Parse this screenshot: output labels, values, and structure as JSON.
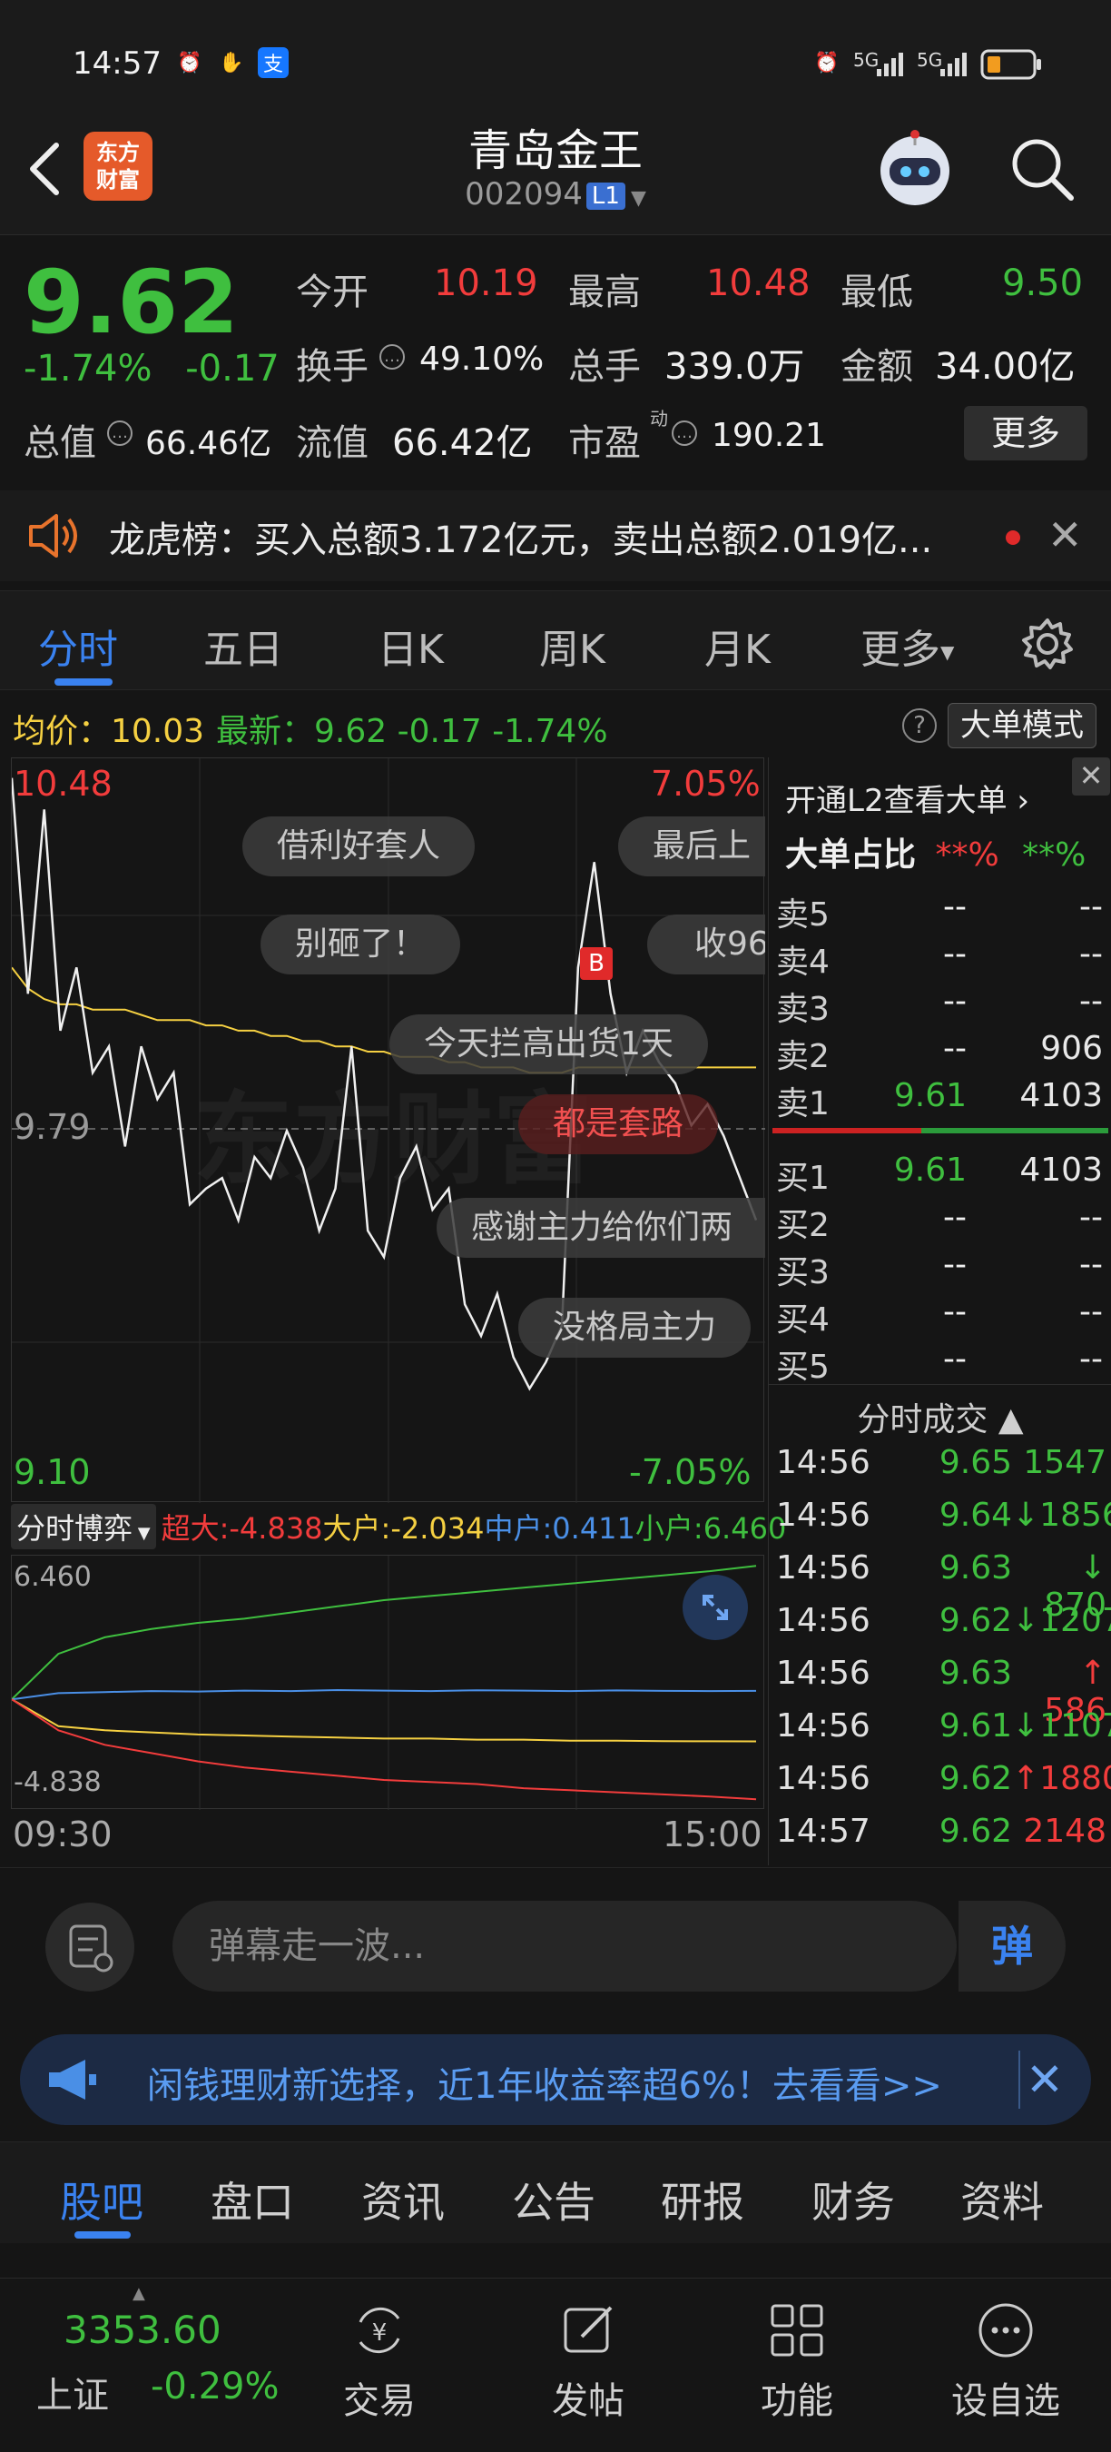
{
  "status_bar": {
    "time": "14:57",
    "net1": "5G",
    "net2": "5G"
  },
  "header": {
    "stock_name": "青岛金王",
    "stock_code": "002094",
    "level_badge": "L1",
    "logo_line1": "东方",
    "logo_line2": "财富"
  },
  "quote": {
    "price": "9.62",
    "change_pct": "-1.74%",
    "change": "-0.17",
    "rows": [
      [
        {
          "k": "今开",
          "v": "10.19",
          "c": "red"
        },
        {
          "k": "最高",
          "v": "10.48",
          "c": "red"
        },
        {
          "k": "最低",
          "v": "9.50",
          "c": "green"
        }
      ],
      [
        {
          "k": "换手",
          "v": "49.10%",
          "c": "white"
        },
        {
          "k": "总手",
          "v": "339.0万",
          "c": "white"
        },
        {
          "k": "金额",
          "v": "34.00亿",
          "c": "white"
        }
      ],
      [
        {
          "k": "总值",
          "v": "66.46亿",
          "c": "white"
        },
        {
          "k": "流值",
          "v": "66.42亿",
          "c": "white"
        },
        {
          "k": "市盈",
          "v": "190.21",
          "c": "white"
        }
      ]
    ],
    "pe_sup": "动",
    "more_label": "更多"
  },
  "notice": {
    "text": "龙虎榜：买入总额3.172亿元，卖出总额2.019亿..."
  },
  "chart_tabs": [
    "分时",
    "五日",
    "日K",
    "周K",
    "月K",
    "更多"
  ],
  "avg_row": {
    "avg": "均价：10.03",
    "latest": "最新：9.62  -0.17  -1.74%",
    "help": "?",
    "big_mode": "大单模式"
  },
  "chart": {
    "y_top": "10.48",
    "pct_top": "7.05%",
    "y_mid": "9.79",
    "y_bottom": "9.10",
    "pct_bottom": "-7.05%",
    "marker": "B",
    "watermark": "东方财富",
    "danmu": [
      "借利好套人",
      "最后上",
      "别砸了！",
      "收96",
      "今天拦高出货1天",
      "都是套路",
      "感谢主力给你们两",
      "没格局主力"
    ]
  },
  "chart_data": {
    "type": "line",
    "title": "",
    "x_range": [
      "09:30",
      "15:00"
    ],
    "ylim": [
      9.1,
      10.48
    ],
    "reference": 9.79,
    "series": [
      {
        "values": [
          10.46,
          10.05,
          10.4,
          9.98,
          10.1,
          9.9,
          9.95,
          9.76,
          9.95,
          9.85,
          9.9,
          9.65,
          9.68,
          9.7,
          9.62,
          9.74,
          9.7,
          9.79,
          9.72,
          9.6,
          9.68,
          9.95,
          9.6,
          9.55,
          9.7,
          9.76,
          9.64,
          9.68,
          9.46,
          9.4,
          9.48,
          9.36,
          9.3,
          9.35,
          9.42,
          10.1,
          10.3,
          10.05,
          9.9,
          9.98,
          9.92,
          9.88,
          9.8,
          9.84,
          9.78,
          9.7,
          9.62
        ]
      },
      {
        "values": [
          10.1,
          10.06,
          10.04,
          10.03,
          10.03,
          10.02,
          10.02,
          10.02,
          10.01,
          10.0,
          10.0,
          10.0,
          9.99,
          9.99,
          9.98,
          9.98,
          9.97,
          9.97,
          9.96,
          9.96,
          9.95,
          9.95,
          9.94,
          9.94,
          9.93,
          9.93,
          9.93,
          9.92,
          9.92,
          9.91,
          9.91,
          9.91,
          9.9,
          9.9,
          9.9,
          9.91,
          9.91,
          9.91,
          9.91,
          9.91,
          9.91,
          9.91,
          9.91,
          9.91,
          9.91,
          9.91,
          9.91
        ]
      }
    ]
  },
  "flow": {
    "select_label": "分时博弈",
    "super": "超大:-4.838",
    "big": "大户:-2.034",
    "mid": "中户:0.411",
    "small": "小户:6.460",
    "y_top": "6.460",
    "y_bottom": "-4.838",
    "time_start": "09:30",
    "time_end": "15:00"
  },
  "flow_data": {
    "type": "line",
    "series": [
      {
        "values": [
          0.0,
          2.2,
          3.0,
          3.4,
          3.7,
          3.9,
          4.2,
          4.5,
          4.8,
          5.0,
          5.2,
          5.4,
          5.6,
          5.8,
          6.0,
          6.2,
          6.46
        ]
      },
      {
        "values": [
          0.0,
          0.3,
          0.35,
          0.4,
          0.38,
          0.42,
          0.4,
          0.45,
          0.42,
          0.4,
          0.44,
          0.42,
          0.4,
          0.43,
          0.41,
          0.4,
          0.411
        ]
      },
      {
        "values": [
          0.0,
          -1.3,
          -1.5,
          -1.6,
          -1.7,
          -1.75,
          -1.8,
          -1.85,
          -1.9,
          -1.9,
          -1.95,
          -1.95,
          -2.0,
          -2.0,
          -2.02,
          -2.03,
          -2.034
        ]
      },
      {
        "values": [
          0.0,
          -1.5,
          -2.2,
          -2.6,
          -3.0,
          -3.3,
          -3.5,
          -3.7,
          -3.9,
          -4.0,
          -4.1,
          -4.3,
          -4.4,
          -4.5,
          -4.6,
          -4.7,
          -4.838
        ]
      }
    ]
  },
  "book": {
    "l2_link": "开通L2查看大单 ›",
    "big_ratio_label": "大单占比",
    "big_ratio_red": "**%",
    "big_ratio_green": "**%",
    "asks": [
      {
        "label": "卖5",
        "price": "--",
        "vol": "--",
        "c": "white"
      },
      {
        "label": "卖4",
        "price": "--",
        "vol": "--",
        "c": "white"
      },
      {
        "label": "卖3",
        "price": "--",
        "vol": "--",
        "c": "white"
      },
      {
        "label": "卖2",
        "price": "--",
        "vol": "906",
        "c": "white"
      },
      {
        "label": "卖1",
        "price": "9.61",
        "vol": "4103",
        "c": "green"
      }
    ],
    "bids": [
      {
        "label": "买1",
        "price": "9.61",
        "vol": "4103",
        "c": "green"
      },
      {
        "label": "买2",
        "price": "--",
        "vol": "--",
        "c": "white"
      },
      {
        "label": "买3",
        "price": "--",
        "vol": "--",
        "c": "white"
      },
      {
        "label": "买4",
        "price": "--",
        "vol": "--",
        "c": "white"
      },
      {
        "label": "买5",
        "price": "--",
        "vol": "--",
        "c": "white"
      }
    ],
    "ticks_title": "分时成交 ▲",
    "ticks": [
      {
        "t": "14:56",
        "p": "9.65",
        "v": "1547",
        "pc": "green",
        "vc": "green"
      },
      {
        "t": "14:56",
        "p": "9.64",
        "v": "↓1856",
        "pc": "green",
        "vc": "green"
      },
      {
        "t": "14:56",
        "p": "9.63",
        "v": "↓ 870",
        "pc": "green",
        "vc": "green"
      },
      {
        "t": "14:56",
        "p": "9.62",
        "v": "↓1207",
        "pc": "green",
        "vc": "green"
      },
      {
        "t": "14:56",
        "p": "9.63",
        "v": "↑ 586",
        "pc": "green",
        "vc": "red"
      },
      {
        "t": "14:56",
        "p": "9.61",
        "v": "↓1107",
        "pc": "green",
        "vc": "green"
      },
      {
        "t": "14:56",
        "p": "9.62",
        "v": "↑1880",
        "pc": "green",
        "vc": "red"
      },
      {
        "t": "14:57",
        "p": "9.62",
        "v": "2148",
        "pc": "green",
        "vc": "red"
      }
    ]
  },
  "comment_bar": {
    "placeholder": "弹幕走一波...",
    "send": "弹"
  },
  "ad": {
    "text": "闲钱理财新选择，近1年收益率超6%！去看看>>"
  },
  "bottom_tabs": [
    "股吧",
    "盘口",
    "资讯",
    "公告",
    "研报",
    "财务",
    "资料"
  ],
  "nav": {
    "index_value": "3353.60",
    "index_name": "上证",
    "index_change": "-0.29%",
    "items": [
      "交易",
      "发帖",
      "功能",
      "设自选"
    ]
  },
  "colors": {
    "up": "#f23c3c",
    "down": "#3fbf3f",
    "accent": "#3a82f0",
    "avg_line": "#f5d042"
  }
}
